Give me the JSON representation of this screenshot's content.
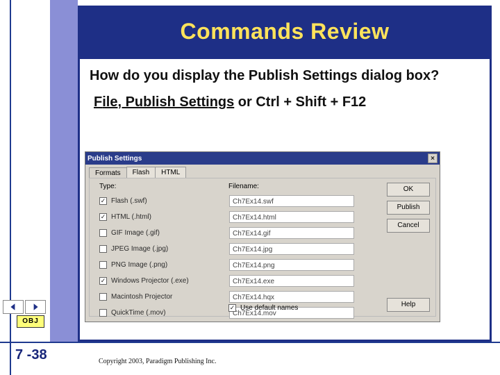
{
  "title": "Commands Review",
  "question": "How do you display the Publish Settings dialog box?",
  "answer_parts": {
    "file": "F",
    "ile_publish": "ile, Publish Settings",
    "or": " or Ctrl + Shift + F12"
  },
  "dialog": {
    "title": "Publish Settings",
    "tabs": [
      "Formats",
      "Flash",
      "HTML"
    ],
    "headers": {
      "type": "Type:",
      "filename": "Filename:"
    },
    "rows": [
      {
        "checked": true,
        "label": "Flash (.swf)",
        "filename": "Ch7Ex14.swf"
      },
      {
        "checked": true,
        "label": "HTML (.html)",
        "filename": "Ch7Ex14.html"
      },
      {
        "checked": false,
        "label": "GIF Image (.gif)",
        "filename": "Ch7Ex14.gif"
      },
      {
        "checked": false,
        "label": "JPEG Image (.jpg)",
        "filename": "Ch7Ex14.jpg"
      },
      {
        "checked": false,
        "label": "PNG Image (.png)",
        "filename": "Ch7Ex14.png"
      },
      {
        "checked": true,
        "label": "Windows Projector (.exe)",
        "filename": "Ch7Ex14.exe"
      },
      {
        "checked": false,
        "label": "Macintosh Projector",
        "filename": "Ch7Ex14.hqx"
      },
      {
        "checked": false,
        "label": "QuickTime (.mov)",
        "filename": "Ch7Ex14.mov"
      }
    ],
    "use_default": "Use default names",
    "buttons": {
      "ok": "OK",
      "publish": "Publish",
      "cancel": "Cancel",
      "help": "Help"
    }
  },
  "nav": {
    "obj": "OBJ"
  },
  "slide_number": "7 -38",
  "copyright": "Copyright 2003, Paradigm Publishing Inc."
}
